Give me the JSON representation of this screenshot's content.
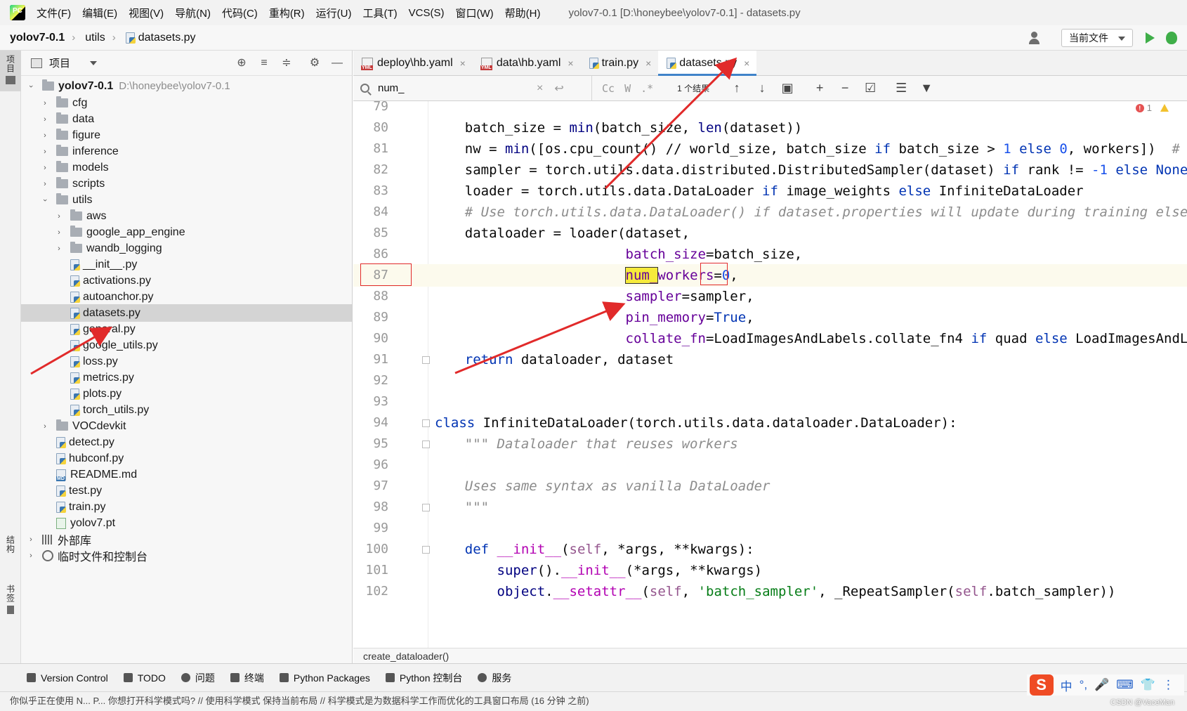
{
  "menubar": {
    "items": [
      "文件(F)",
      "编辑(E)",
      "视图(V)",
      "导航(N)",
      "代码(C)",
      "重构(R)",
      "运行(U)",
      "工具(T)",
      "VCS(S)",
      "窗口(W)",
      "帮助(H)"
    ],
    "window_title": "yolov7-0.1 [D:\\honeybee\\yolov7-0.1] - datasets.py"
  },
  "navbar": {
    "crumbs": [
      "yolov7-0.1",
      "utils",
      "datasets.py"
    ],
    "run_config": "当前文件"
  },
  "left_stripe": {
    "project": "项目",
    "structure": "结构",
    "bookmarks": "书签"
  },
  "project_panel": {
    "title": "项目",
    "root_name": "yolov7-0.1",
    "root_path": "D:\\honeybee\\yolov7-0.1",
    "rows": [
      {
        "label": "cfg"
      },
      {
        "label": "data"
      },
      {
        "label": "figure"
      },
      {
        "label": "inference"
      },
      {
        "label": "models"
      },
      {
        "label": "scripts"
      },
      {
        "label": "utils"
      },
      {
        "label": "aws"
      },
      {
        "label": "google_app_engine"
      },
      {
        "label": "wandb_logging"
      },
      {
        "label": "__init__.py"
      },
      {
        "label": "activations.py"
      },
      {
        "label": "autoanchor.py"
      },
      {
        "label": "datasets.py"
      },
      {
        "label": "general.py"
      },
      {
        "label": "google_utils.py"
      },
      {
        "label": "loss.py"
      },
      {
        "label": "metrics.py"
      },
      {
        "label": "plots.py"
      },
      {
        "label": "torch_utils.py"
      },
      {
        "label": "VOCdevkit"
      },
      {
        "label": "detect.py"
      },
      {
        "label": "hubconf.py"
      },
      {
        "label": "README.md"
      },
      {
        "label": "test.py"
      },
      {
        "label": "train.py"
      },
      {
        "label": "yolov7.pt"
      },
      {
        "label": "外部库"
      },
      {
        "label": "临时文件和控制台"
      }
    ]
  },
  "tabs": [
    {
      "label": "deploy\\hb.yaml"
    },
    {
      "label": "data\\hb.yaml"
    },
    {
      "label": "train.py"
    },
    {
      "label": "datasets.py"
    }
  ],
  "findbar": {
    "query": "num_",
    "opt_case": "Cc",
    "opt_word": "W",
    "opt_regex": ".*",
    "result": "1 个结果"
  },
  "editor": {
    "inspection_errors": "1",
    "line_numbers": [
      "79",
      "80",
      "81",
      "82",
      "83",
      "84",
      "85",
      "86",
      "87",
      "88",
      "89",
      "90",
      "91",
      "92",
      "93",
      "94",
      "95",
      "96",
      "97",
      "98",
      "99",
      "100",
      "101",
      "102"
    ],
    "current_line": "87",
    "breadcrumb": "create_dataloader()"
  },
  "tool_windows": [
    "Version Control",
    "TODO",
    "问题",
    "终端",
    "Python Packages",
    "Python 控制台",
    "服务"
  ],
  "status_text": "你似乎正在使用 N... P... 你想打开科学模式吗? // 使用科学模式   保持当前布局 // 科学模式是为数据科学工作而优化的工具窗口布局 (16 分钟 之前)",
  "ime": {
    "items": [
      "中",
      "°,",
      "🎤",
      "⌨",
      "👕",
      "⋮"
    ]
  },
  "watermark": "CSDN @VaceMan",
  "colors": {
    "keyword": "#0033b3",
    "number": "#1750eb",
    "string": "#067d17",
    "comment": "#8c8c8c",
    "param": "#660099",
    "annotation_red": "#e12a2a",
    "selection": "#d4d4d4",
    "search_highlight": "#f6ea3b"
  }
}
